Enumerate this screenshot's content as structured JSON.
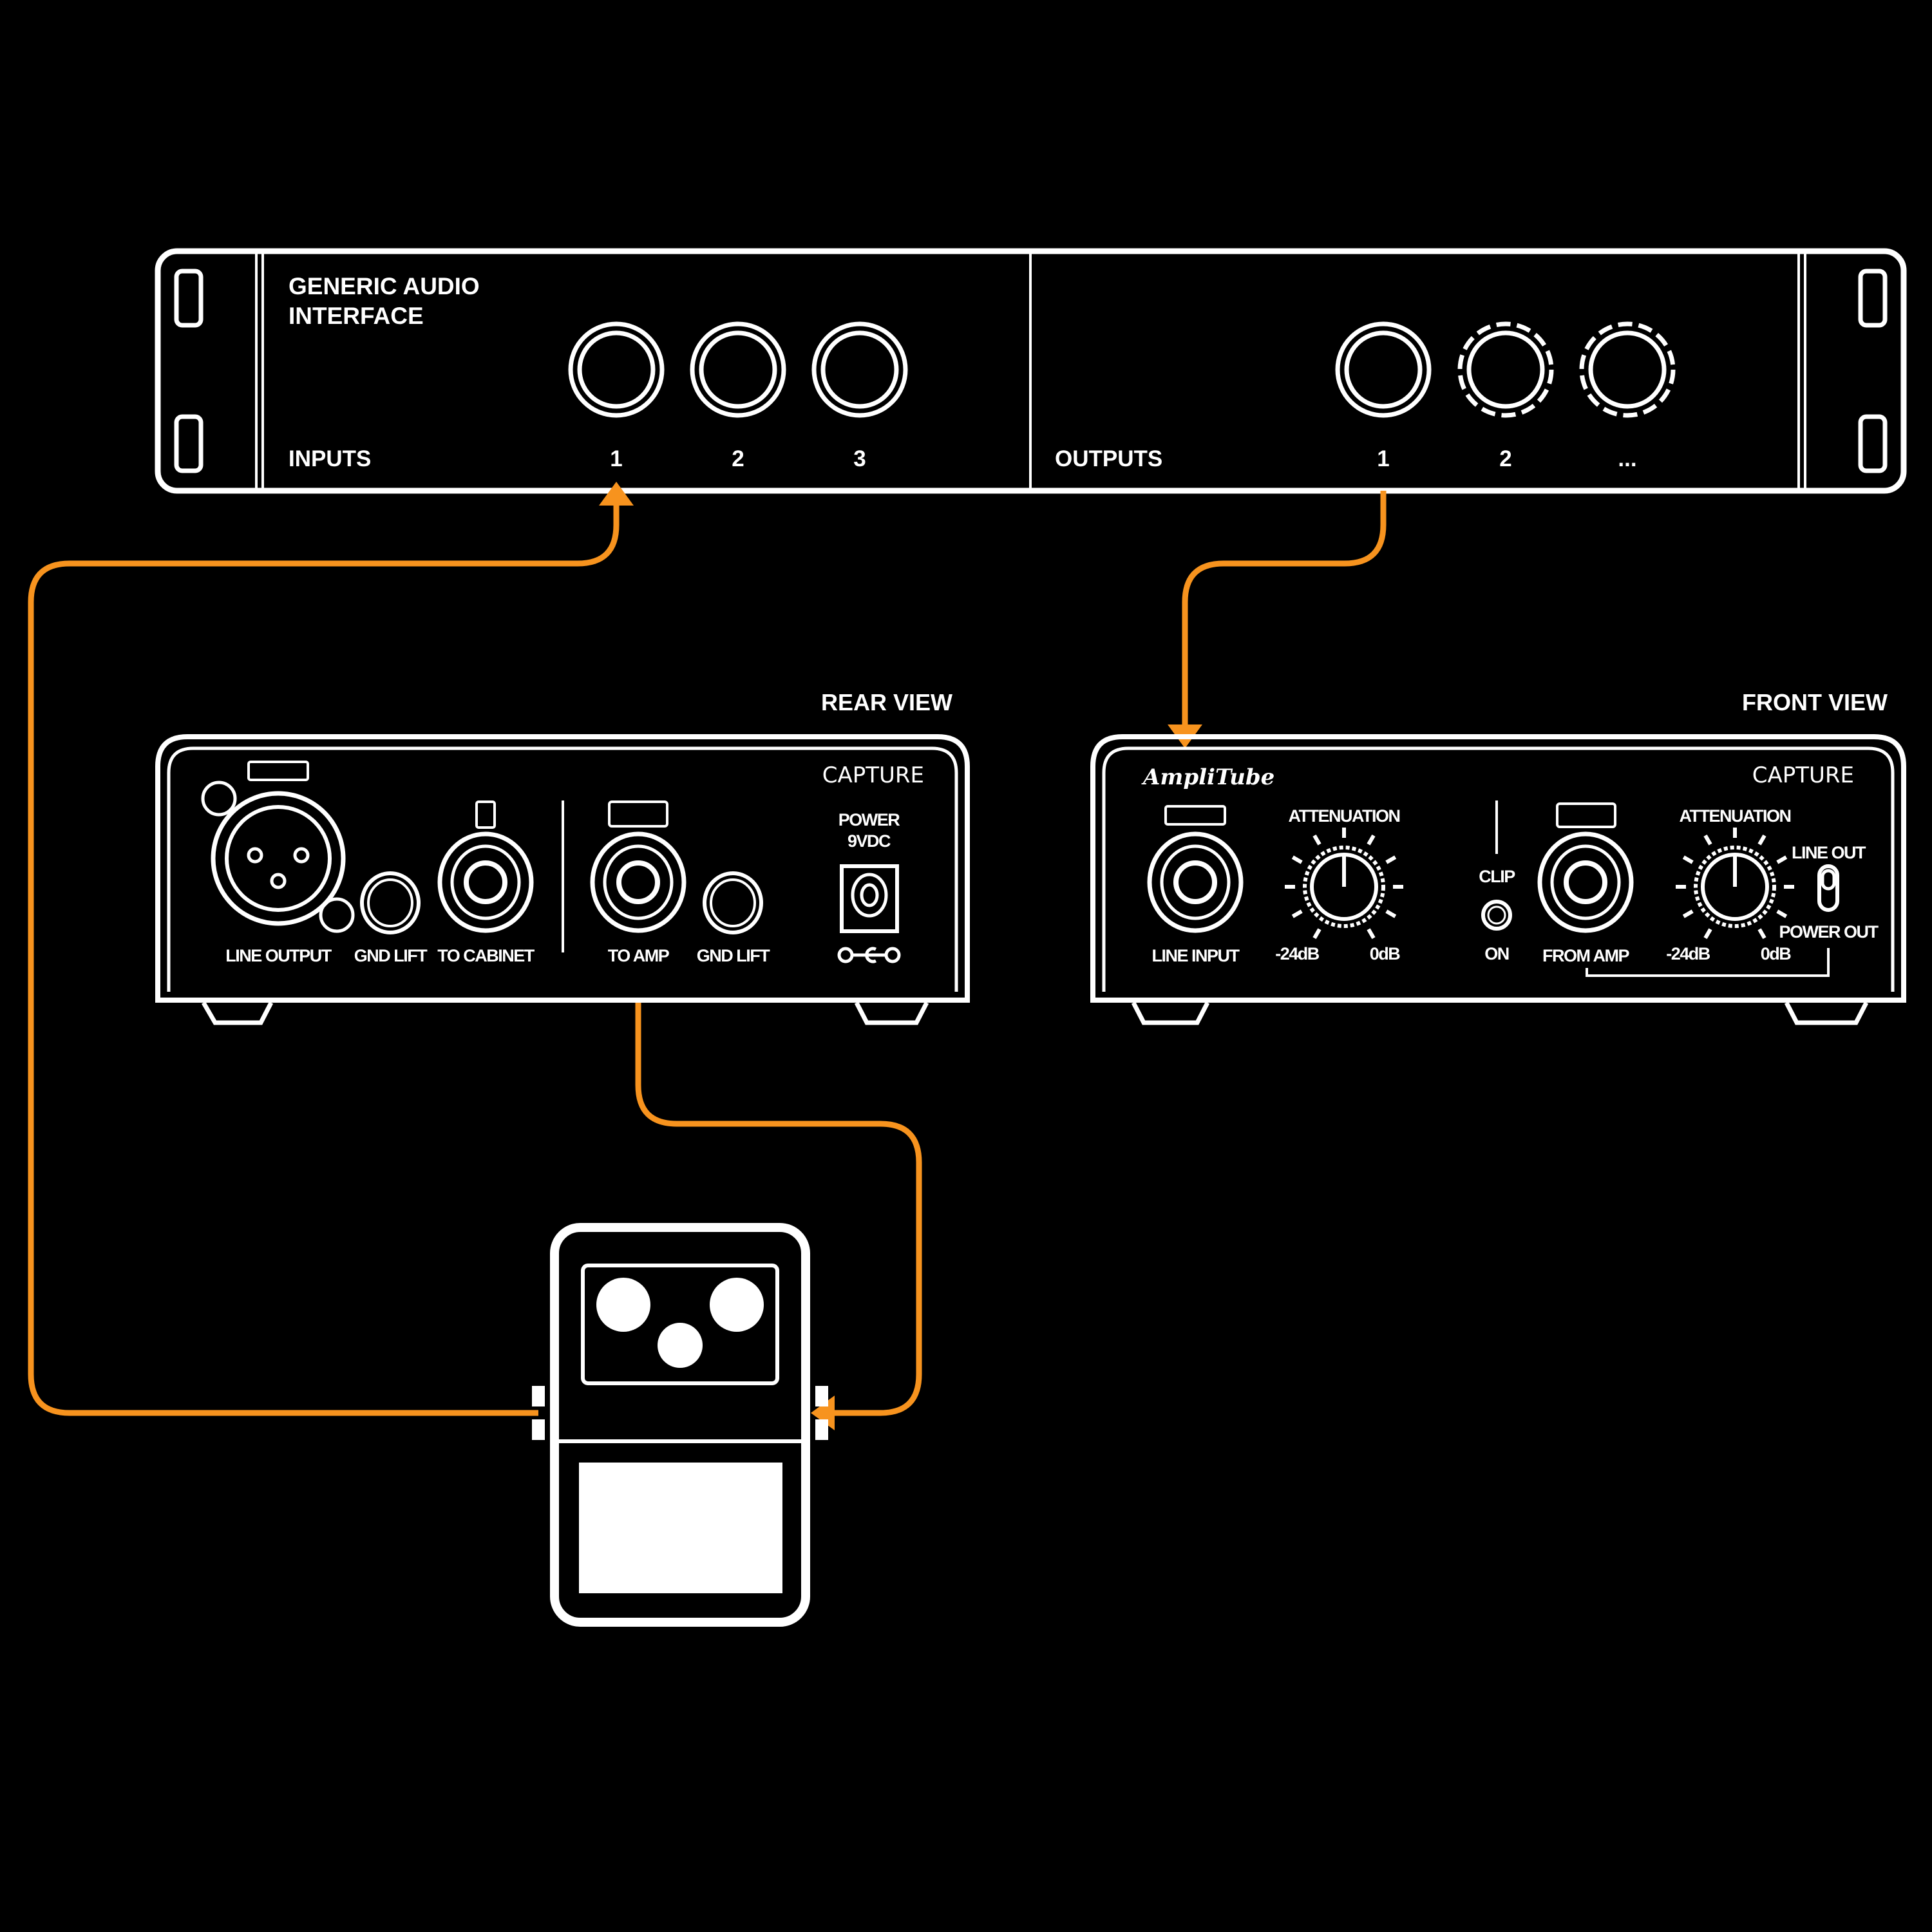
{
  "colors": {
    "background": "#000000",
    "line": "#ffffff",
    "cable": "#f7931e"
  },
  "interface": {
    "title_line1": "GENERIC AUDIO",
    "title_line2": "INTERFACE",
    "inputs_label": "INPUTS",
    "input_numbers": [
      "1",
      "2",
      "3"
    ],
    "outputs_label": "OUTPUTS",
    "output_numbers": [
      "1",
      "2",
      "..."
    ]
  },
  "rear_view": {
    "heading": "REAR VIEW",
    "brand": "CAPTURE",
    "power_line1": "POWER",
    "power_line2": "9VDC",
    "labels": {
      "line_output": "LINE OUTPUT",
      "gnd_lift_1": "GND LIFT",
      "to_cabinet": "TO CABINET",
      "to_amp": "TO AMP",
      "gnd_lift_2": "GND LIFT"
    }
  },
  "front_view": {
    "heading": "FRONT VIEW",
    "logo": "AmpliTube",
    "brand": "CAPTURE",
    "line_input": "LINE INPUT",
    "attenuation_1": "ATTENUATION",
    "min_1": "-24dB",
    "max_1": "0dB",
    "clip": "CLIP",
    "on": "ON",
    "from_amp": "FROM AMP",
    "attenuation_2": "ATTENUATION",
    "min_2": "-24dB",
    "max_2": "0dB",
    "switch_top": "LINE OUT",
    "switch_bottom": "POWER OUT"
  }
}
